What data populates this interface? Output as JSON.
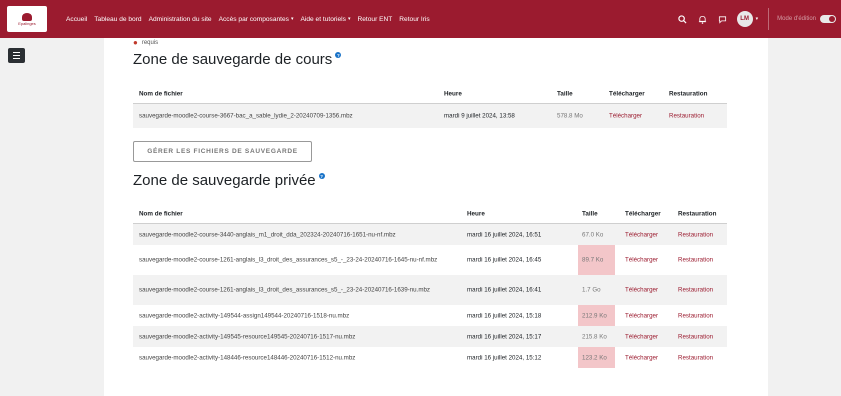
{
  "navbar": {
    "logo_text": "Epalinges",
    "items": [
      {
        "label": "Accueil",
        "dropdown": false
      },
      {
        "label": "Tableau de bord",
        "dropdown": false
      },
      {
        "label": "Administration du site",
        "dropdown": false
      },
      {
        "label": "Accès par composantes",
        "dropdown": true
      },
      {
        "label": "Aide et tutoriels",
        "dropdown": true
      },
      {
        "label": "Retour ENT",
        "dropdown": false
      },
      {
        "label": "Retour Iris",
        "dropdown": false
      }
    ],
    "avatar_initials": "LM",
    "edit_mode_label": "Mode d'édition"
  },
  "required_label": "requis",
  "course_backup": {
    "title": "Zone de sauvegarde de cours",
    "headers": {
      "filename": "Nom de fichier",
      "time": "Heure",
      "size": "Taille",
      "download": "Télécharger",
      "restore": "Restauration"
    },
    "rows": [
      {
        "filename": "sauvegarde-moodle2-course-3667-bac_a_sable_lydie_2-20240709-1356.mbz",
        "time": "mardi 9 juillet 2024, 13:58",
        "size": "578.8 Mo",
        "download": "Télécharger",
        "restore": "Restauration"
      }
    ]
  },
  "manage_button_label": "GÉRER LES FICHIERS DE SAUVEGARDE",
  "private_backup": {
    "title": "Zone de sauvegarde privée",
    "headers": {
      "filename": "Nom de fichier",
      "time": "Heure",
      "size": "Taille",
      "download": "Télécharger",
      "restore": "Restauration"
    },
    "rows": [
      {
        "filename": "sauvegarde-moodle2-course-3440-anglais_m1_droit_dda_202324-20240716-1651-nu-nf.mbz",
        "time": "mardi 16 juillet 2024, 16:51",
        "size": "67.0 Ko",
        "download": "Télécharger",
        "restore": "Restauration"
      },
      {
        "filename": "sauvegarde-moodle2-course-1261-anglais_l3_droit_des_assurances_s5_-_23-24-20240716-1645-nu-nf.mbz",
        "time": "mardi 16 juillet 2024, 16:45",
        "size": "89.7 Ko",
        "download": "Télécharger",
        "restore": "Restauration"
      },
      {
        "filename": "sauvegarde-moodle2-course-1261-anglais_l3_droit_des_assurances_s5_-_23-24-20240716-1639-nu.mbz",
        "time": "mardi 16 juillet 2024, 16:41",
        "size": "1.7 Go",
        "download": "Télécharger",
        "restore": "Restauration"
      },
      {
        "filename": "sauvegarde-moodle2-activity-149544-assign149544-20240716-1518-nu.mbz",
        "time": "mardi 16 juillet 2024, 15:18",
        "size": "212.9 Ko",
        "download": "Télécharger",
        "restore": "Restauration"
      },
      {
        "filename": "sauvegarde-moodle2-activity-149545-resource149545-20240716-1517-nu.mbz",
        "time": "mardi 16 juillet 2024, 15:17",
        "size": "215.8 Ko",
        "download": "Télécharger",
        "restore": "Restauration"
      },
      {
        "filename": "sauvegarde-moodle2-activity-148446-resource148446-20240716-1512-nu.mbz",
        "time": "mardi 16 juillet 2024, 15:12",
        "size": "123.2 Ko",
        "download": "Télécharger",
        "restore": "Restauration"
      }
    ]
  },
  "colors": {
    "brand": "#9b1b2f",
    "size_highlight": "#f3c6c9",
    "help_icon": "#1a73c8"
  },
  "icons": [
    "search-icon",
    "bell-icon",
    "chat-icon",
    "drawer-toggle-icon",
    "help-icon",
    "required-icon"
  ]
}
